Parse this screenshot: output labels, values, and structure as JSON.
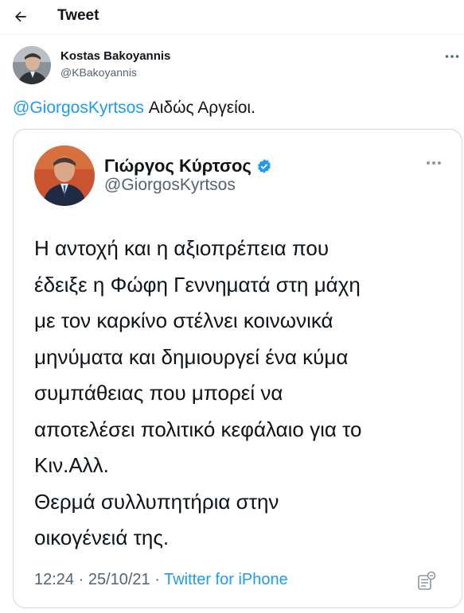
{
  "header": {
    "back_icon": "arrow-left-icon",
    "title": "Tweet"
  },
  "tweet": {
    "author_name": "Kostas Bakoyannis",
    "author_handle": "@KBakoyannis",
    "more_icon": "more-horizontal-icon",
    "mention": "@GiorgosKyrtsos",
    "text": "Αιδώς Αργείοι."
  },
  "quoted": {
    "author_name": "Γιώργος Κύρτσος",
    "verified_icon": "verified-badge-icon",
    "author_handle": "@GiorgosKyrtsos",
    "more_icon": "more-horizontal-icon",
    "body_lines": [
      "Η αντοχή και η αξιοπρέπεια που",
      "έδειξε η Φώφη Γεννηματά στη μάχη",
      "με τον καρκίνο στέλνει κοινωνικά",
      "μηνύματα και δημιουργεί ένα κύμα",
      "συμπάθειας που μπορεί να",
      "αποτελέσει πολιτικό κεφάλαιο για το",
      "Κιν.Αλλ.",
      "Θερμά συλλυπητήρια στην",
      "οικογένειά της."
    ],
    "timestamp": "12:24 · 25/10/21 · ",
    "source": "Twitter for iPhone",
    "analytics_icon": "analytics-icon"
  },
  "colors": {
    "accent": "#1d9bf0",
    "text_primary": "#0f1419",
    "text_secondary": "#536471",
    "border": "#cfd9de"
  }
}
